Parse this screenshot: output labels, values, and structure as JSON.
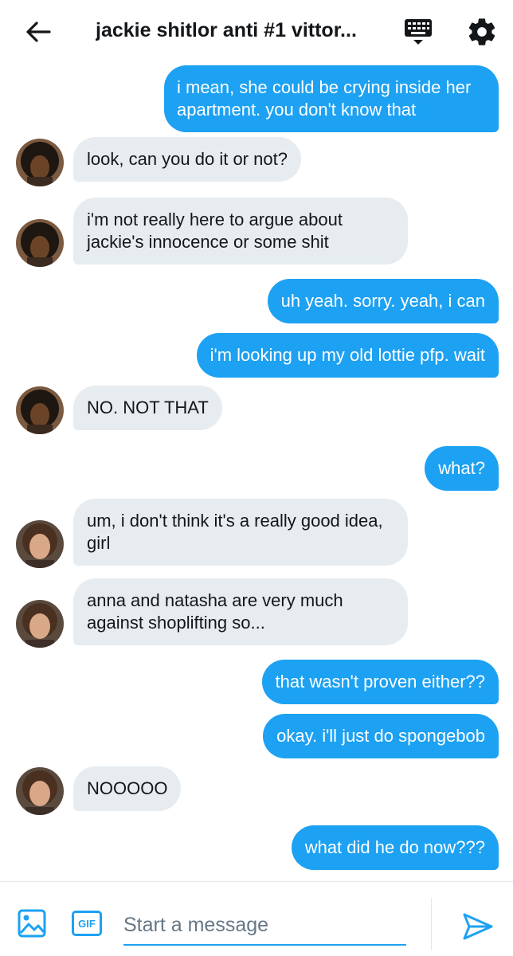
{
  "header": {
    "title": "jackie shitlor anti #1 vittor...",
    "icons": {
      "back": "arrow-left-icon",
      "keyboard": "keyboard-icon",
      "settings": "gear-icon"
    }
  },
  "messages": [
    {
      "side": "out",
      "text": "i mean, she could be crying inside her apartment. you don't know that"
    },
    {
      "side": "in",
      "avatar": "a",
      "text": "look, can you do it or not?"
    },
    {
      "side": "in",
      "avatar": "a",
      "text": "i'm not really here to argue about jackie's innocence or some shit"
    },
    {
      "side": "out",
      "text": "uh yeah. sorry. yeah, i can"
    },
    {
      "side": "out",
      "text": "i'm looking up my old lottie pfp. wait"
    },
    {
      "side": "in",
      "avatar": "a",
      "text": "NO. NOT THAT"
    },
    {
      "side": "out",
      "text": "what?"
    },
    {
      "side": "in",
      "avatar": "b",
      "text": "um, i don't think it's a really good idea, girl"
    },
    {
      "side": "in",
      "avatar": "b",
      "text": "anna and natasha are very much against shoplifting so..."
    },
    {
      "side": "out",
      "text": "that wasn't proven either??"
    },
    {
      "side": "out",
      "text": "okay. i'll just do spongebob"
    },
    {
      "side": "in",
      "avatar": "b",
      "text": "NOOOOO"
    },
    {
      "side": "out",
      "text": "what did he do now???"
    }
  ],
  "composer": {
    "placeholder": "Start a message",
    "gif_label": "GIF",
    "icons": {
      "image": "image-icon",
      "send": "send-icon"
    }
  },
  "colors": {
    "accent": "#1da1f2",
    "incoming_bubble": "#e6ecf0",
    "text": "#14171a",
    "muted": "#657786"
  }
}
